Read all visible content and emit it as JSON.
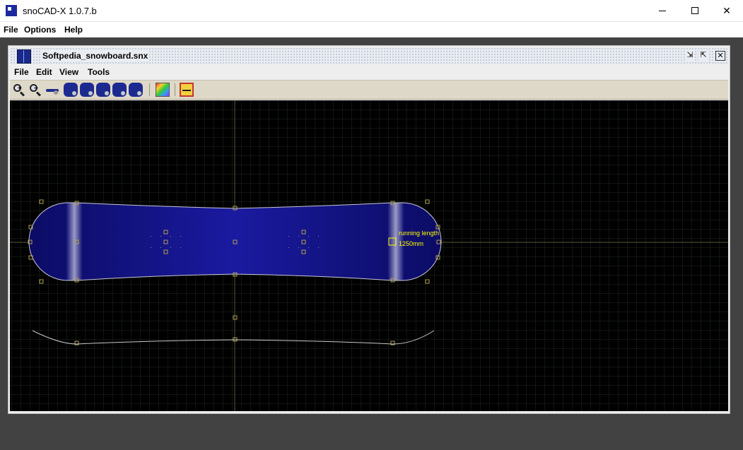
{
  "window": {
    "title": "snoCAD-X 1.0.7.b",
    "minimize_glyph": "",
    "close_glyph": "✕"
  },
  "menubar": [
    "File",
    "Options",
    "Help"
  ],
  "document": {
    "title": "Softpedia_snowboard.snx",
    "restore_glyph": "⇲",
    "maximize_glyph": "⇱",
    "close_glyph": "✕"
  },
  "doc_menubar": [
    "File",
    "Edit",
    "View",
    "Tools"
  ],
  "toolbar": {
    "icons": [
      "zoom-in-icon",
      "zoom-out-icon",
      "pan-icon",
      "board-view-icon",
      "board-edit-icon",
      "board-edit-2-icon",
      "board-edit-3-icon",
      "board-side-icon",
      "color-palette-icon",
      "ruler-icon"
    ]
  },
  "canvas": {
    "annotation_label": "running length",
    "annotation_value": "1250mm"
  },
  "colors": {
    "board_fill": "#0f0f6e",
    "grid": "#1e2a1e",
    "axis": "#5a5a3a",
    "handle": "#b0a050",
    "annotation": "#ffff00",
    "outline": "#c8c8d8"
  }
}
